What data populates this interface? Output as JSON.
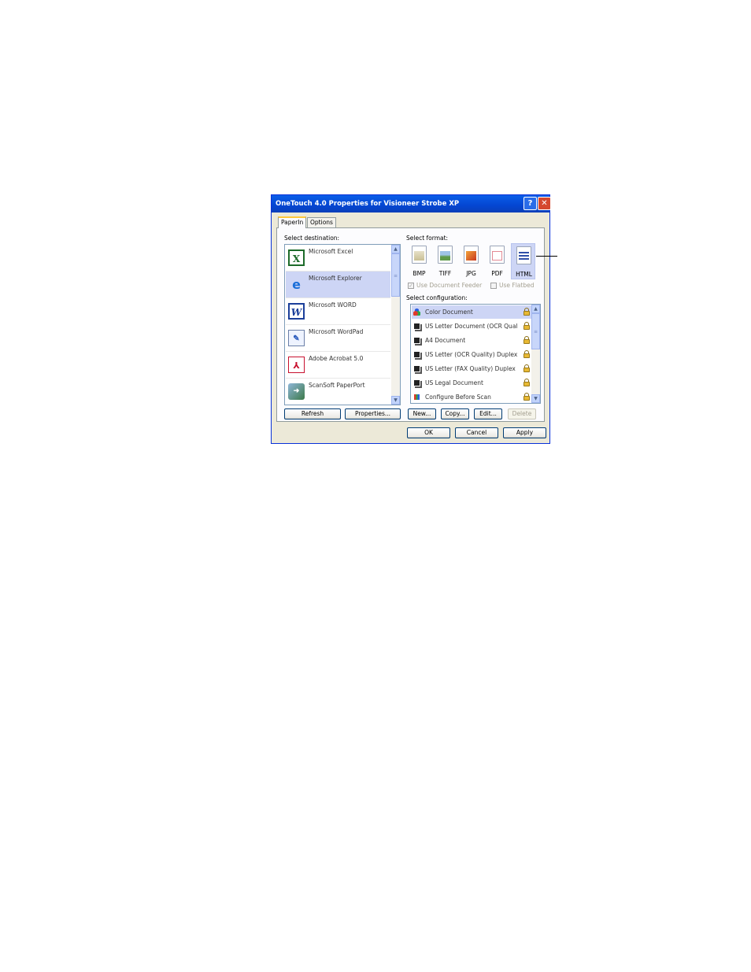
{
  "window": {
    "title": "OneTouch 4.0 Properties for Visioneer Strobe XP",
    "help_glyph": "?",
    "close_glyph": "✕"
  },
  "tabs": [
    {
      "label": "PaperIn",
      "active": true
    },
    {
      "label": "Options",
      "active": false
    }
  ],
  "destination": {
    "label": "Select destination:",
    "items": [
      {
        "label": "Microsoft Excel",
        "icon": "excel-icon",
        "selected": false
      },
      {
        "label": "Microsoft Explorer",
        "icon": "internet-explorer-icon",
        "selected": true
      },
      {
        "label": "Microsoft WORD",
        "icon": "word-icon",
        "selected": false
      },
      {
        "label": "Microsoft WordPad",
        "icon": "wordpad-icon",
        "selected": false
      },
      {
        "label": "Adobe Acrobat 5.0",
        "icon": "acrobat-icon",
        "selected": false
      },
      {
        "label": "ScanSoft PaperPort",
        "icon": "paperport-icon",
        "selected": false
      }
    ],
    "refresh_label": "Refresh",
    "properties_label": "Properties..."
  },
  "format": {
    "label": "Select format:",
    "items": [
      {
        "label": "BMP",
        "icon": "bmp-file-icon",
        "selected": false
      },
      {
        "label": "TIFF",
        "icon": "tiff-file-icon",
        "selected": false
      },
      {
        "label": "JPG",
        "icon": "jpg-file-icon",
        "selected": false
      },
      {
        "label": "PDF",
        "icon": "pdf-file-icon",
        "selected": false
      },
      {
        "label": "HTML",
        "icon": "html-file-icon",
        "selected": true
      }
    ],
    "use_document_feeder": {
      "label": "Use Document Feeder",
      "checked": true,
      "enabled": false
    },
    "use_flatbed": {
      "label": "Use Flatbed",
      "checked": false,
      "enabled": false
    }
  },
  "configuration": {
    "label": "Select configuration:",
    "items": [
      {
        "label": "Color Document",
        "icon": "color-document-icon",
        "selected": true,
        "locked": true
      },
      {
        "label": "US Letter Document (OCR Qualit",
        "icon": "bw-document-icon",
        "selected": false,
        "locked": true
      },
      {
        "label": "A4 Document",
        "icon": "bw-document-icon",
        "selected": false,
        "locked": true
      },
      {
        "label": "US Letter (OCR Quality) Duplex",
        "icon": "bw-document-icon",
        "selected": false,
        "locked": true
      },
      {
        "label": "US Letter (FAX Quality) Duplex",
        "icon": "bw-document-icon",
        "selected": false,
        "locked": true
      },
      {
        "label": "US Legal Document",
        "icon": "bw-document-icon",
        "selected": false,
        "locked": true
      },
      {
        "label": "Configure Before Scan",
        "icon": "configure-scan-icon",
        "selected": false,
        "locked": true
      }
    ],
    "new_label": "New...",
    "copy_label": "Copy...",
    "edit_label": "Edit...",
    "delete_label": "Delete"
  },
  "footer": {
    "ok_label": "OK",
    "cancel_label": "Cancel",
    "apply_label": "Apply"
  },
  "colors": {
    "titlebar": "#0446d2",
    "selection": "#cdd5f5",
    "dialog_face": "#ece9d8"
  }
}
